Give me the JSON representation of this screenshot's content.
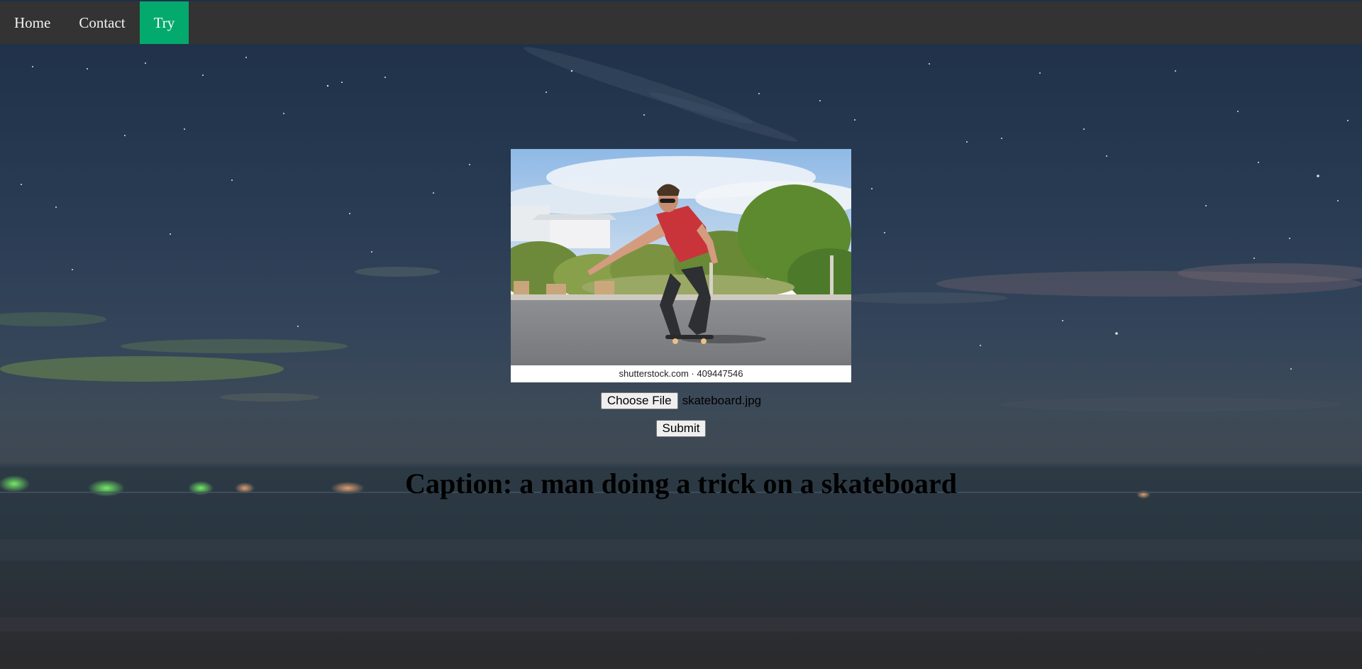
{
  "nav": {
    "items": [
      {
        "label": "Home",
        "active": false
      },
      {
        "label": "Contact",
        "active": false
      },
      {
        "label": "Try",
        "active": true
      }
    ],
    "active_color": "#04aa6d",
    "bar_color": "#333333"
  },
  "upload": {
    "preview_watermark": "shutterstock.com · 409447546",
    "choose_label": "Choose File",
    "file_name": "skateboard.jpg",
    "submit_label": "Submit"
  },
  "result": {
    "caption": "Caption: a man doing a trick on a skateboard"
  }
}
